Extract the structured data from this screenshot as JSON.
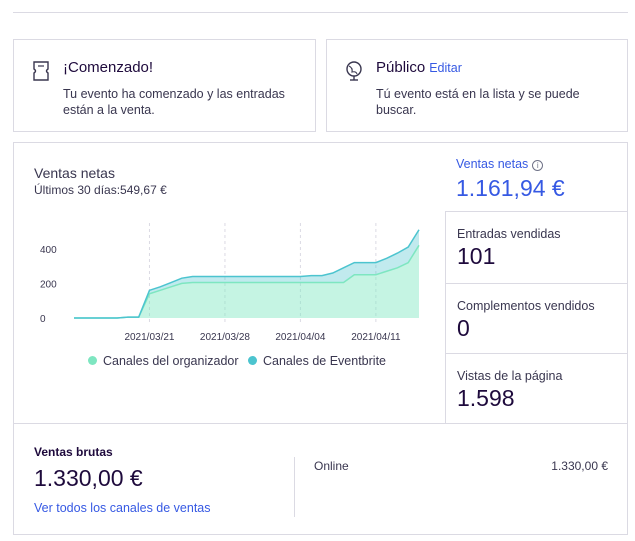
{
  "status_cards": {
    "started": {
      "icon": "ticket-icon",
      "title": "¡Comenzado!",
      "description": "Tu evento ha comenzado y las entradas están a la venta."
    },
    "public": {
      "icon": "globe-icon",
      "title": "Público",
      "edit_link": "Editar",
      "description": "Tú evento está en la lista y se puede buscar."
    }
  },
  "net_sales_chart": {
    "title": "Ventas netas",
    "subtitle": "Últimos 30 días:549,67 €",
    "legend": [
      {
        "label": "Canales del organizador",
        "color": "#7ee6c1"
      },
      {
        "label": "Canales de Eventbrite",
        "color": "#4cc4cf"
      }
    ]
  },
  "chart_data": {
    "type": "area",
    "x": [
      "2021/03/14",
      "2021/03/15",
      "2021/03/16",
      "2021/03/17",
      "2021/03/18",
      "2021/03/19",
      "2021/03/20",
      "2021/03/21",
      "2021/03/22",
      "2021/03/23",
      "2021/03/24",
      "2021/03/25",
      "2021/03/26",
      "2021/03/27",
      "2021/03/28",
      "2021/03/29",
      "2021/03/30",
      "2021/03/31",
      "2021/04/01",
      "2021/04/02",
      "2021/04/03",
      "2021/04/04",
      "2021/04/05",
      "2021/04/06",
      "2021/04/07",
      "2021/04/08",
      "2021/04/09",
      "2021/04/10",
      "2021/04/11",
      "2021/04/12",
      "2021/04/13",
      "2021/04/14",
      "2021/04/15"
    ],
    "xtick_labels": [
      "2021/03/21",
      "2021/03/28",
      "2021/04/04",
      "2021/04/11"
    ],
    "yticks": [
      0,
      200,
      400
    ],
    "ylim": [
      0,
      520
    ],
    "series": [
      {
        "name": "Canales del organizador",
        "color": "#7ee6c1",
        "values": [
          0,
          0,
          0,
          0,
          0,
          5,
          5,
          140,
          160,
          180,
          200,
          205,
          205,
          205,
          205,
          205,
          205,
          205,
          205,
          205,
          205,
          205,
          205,
          205,
          205,
          205,
          250,
          250,
          250,
          270,
          290,
          320,
          420
        ]
      },
      {
        "name": "Canales de Eventbrite",
        "color": "#4cc4cf",
        "values": [
          0,
          0,
          0,
          0,
          0,
          5,
          5,
          160,
          180,
          205,
          230,
          240,
          240,
          240,
          240,
          240,
          240,
          240,
          240,
          240,
          240,
          240,
          245,
          245,
          260,
          290,
          320,
          320,
          320,
          345,
          375,
          410,
          510
        ]
      }
    ],
    "grid": "vertical-dashed"
  },
  "metrics": {
    "net_sales": {
      "label": "Ventas netas",
      "value": "1.161,94 €"
    },
    "tickets_sold": {
      "label": "Entradas vendidas",
      "value": "101"
    },
    "addons_sold": {
      "label": "Complementos vendidos",
      "value": "0"
    },
    "page_views": {
      "label": "Vistas de la página",
      "value": "1.598"
    }
  },
  "gross_sales": {
    "label": "Ventas brutas",
    "value": "1.330,00 €",
    "link": "Ver todos los canales de ventas",
    "channel_label": "Online",
    "channel_value": "1.330,00 €"
  }
}
